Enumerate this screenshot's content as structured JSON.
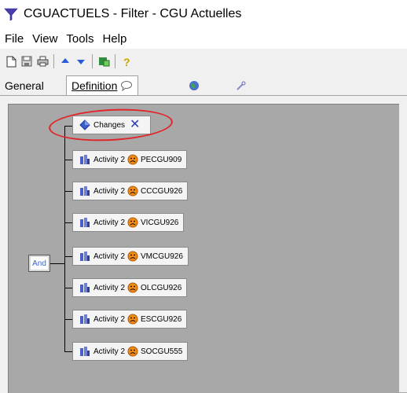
{
  "window": {
    "title": "CGUACTUELS - Filter - CGU Actuelles",
    "icon": "filter-funnel-icon"
  },
  "menu": [
    "File",
    "View",
    "Tools",
    "Help"
  ],
  "toolbar": {
    "buttons": [
      "new-icon",
      "save-icon",
      "print-icon",
      "move-up-icon",
      "move-down-icon",
      "add-condition-icon",
      "help-icon"
    ]
  },
  "tabs": {
    "general": "General",
    "definition": "Definition",
    "definition_icon": "speech-bubble-icon",
    "tab3_icon": "globe-icon",
    "tab4_icon": "link-icon"
  },
  "tree": {
    "root_label": "And",
    "changes_label": "Changes",
    "activities": [
      {
        "label": "Activity 2",
        "code": "PECGU909"
      },
      {
        "label": "Activity 2",
        "code": "CCCGU926"
      },
      {
        "label": "Activity 2",
        "code": "VICGU926"
      },
      {
        "label": "Activity 2",
        "code": "VMCGU926"
      },
      {
        "label": "Activity 2",
        "code": "OLCGU926"
      },
      {
        "label": "Activity 2",
        "code": "ESCGU926"
      },
      {
        "label": "Activity 2",
        "code": "SOCGU555"
      }
    ]
  },
  "colors": {
    "canvas": "#a8a8a8",
    "highlight_ellipse": "#e0262b",
    "delete_x": "#2b3fb3"
  }
}
